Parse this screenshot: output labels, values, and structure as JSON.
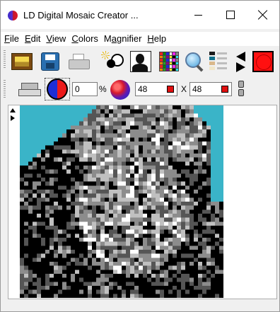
{
  "window": {
    "title": "LD Digital Mosaic Creator ...",
    "minimize_label": "",
    "maximize_label": "",
    "close_label": ""
  },
  "menu": [
    {
      "prefix": "",
      "accel": "F",
      "rest": "ile"
    },
    {
      "prefix": "",
      "accel": "E",
      "rest": "dit"
    },
    {
      "prefix": "",
      "accel": "V",
      "rest": "iew"
    },
    {
      "prefix": "",
      "accel": "C",
      "rest": "olors"
    },
    {
      "prefix": "M",
      "accel": "a",
      "rest": "gnifier"
    },
    {
      "prefix": "",
      "accel": "H",
      "rest": "elp"
    }
  ],
  "toolbar": {
    "percent_value": "0",
    "percent_sign": "%",
    "width_value": "48",
    "times_sign": "X",
    "height_value": "48"
  },
  "colors": {
    "mosaic_background": "#3ab4c8",
    "mosaic_palette": [
      "#000000",
      "#555555",
      "#8c8c8c",
      "#c0c0c0",
      "#ffffff"
    ],
    "accent_red": "#ff1010"
  },
  "icons": [
    "open-image-icon",
    "save-icon",
    "print-icon",
    "brightness-icon",
    "portrait-icon",
    "color-grid-icon",
    "magnifier-icon",
    "palette-icon",
    "arrows-icon",
    "red-color-icon",
    "eraser-icon",
    "half-color-icon",
    "color-ball-icon",
    "link-icon"
  ]
}
